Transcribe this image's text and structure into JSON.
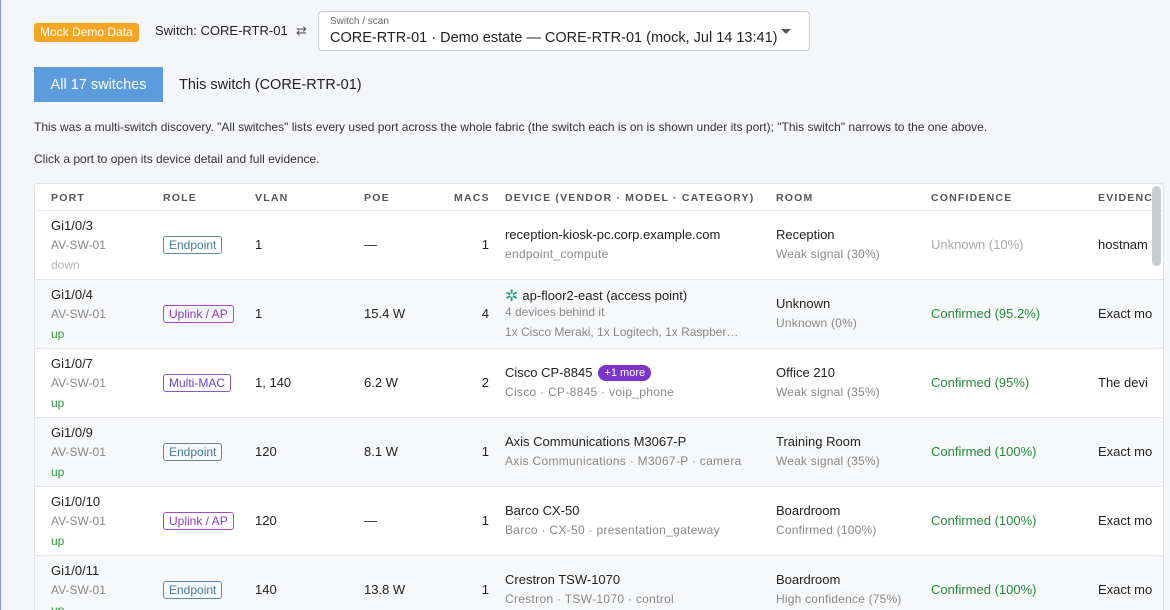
{
  "header": {
    "mock_badge": "Mock Demo Data",
    "switch_label": "Switch: CORE-RTR-01",
    "swap_icon": "swap-arrows-icon",
    "select_legend": "Switch / scan",
    "select_value": "CORE-RTR-01 · Demo estate — CORE-RTR-01 (mock, Jul 14 13:41)"
  },
  "tabs": {
    "all": "All 17 switches",
    "this": "This switch (CORE-RTR-01)"
  },
  "info": {
    "line1": "This was a multi-switch discovery. \"All switches\" lists every used port across the whole fabric (the switch each is on is shown under its port); \"This switch\" narrows to the one above.",
    "line2": "Click a port to open its device detail and full evidence."
  },
  "table": {
    "columns": [
      "PORT",
      "ROLE",
      "VLAN",
      "POE",
      "MACS",
      "DEVICE (VENDOR · MODEL · CATEGORY)",
      "ROOM",
      "CONFIDENCE",
      "EVIDENCE"
    ],
    "rows": [
      {
        "port": "Gi1/0/3",
        "switch": "AV-SW-01",
        "status": "down",
        "role": "Endpoint",
        "vlan": "1",
        "poe": "—",
        "macs": "1",
        "device": "reception-kiosk-pc.corp.example.com",
        "device_sub": "endpoint_compute",
        "room": "Reception",
        "room_sub": "Weak signal (30%)",
        "confidence": "Unknown (10%)",
        "evidence": "hostnam"
      },
      {
        "port": "Gi1/0/4",
        "switch": "AV-SW-01",
        "status": "up",
        "role": "Uplink / AP",
        "vlan": "1",
        "poe": "15.4 W",
        "macs": "4",
        "device": "ap-floor2-east (access point)",
        "device_sub": "4 devices behind it",
        "device_sub2": "1x Cisco Meraki, 1x Logitech, 1x Raspber…",
        "room": "Unknown",
        "room_sub": "Unknown (0%)",
        "confidence": "Confirmed (95.2%)",
        "evidence": "Exact mo"
      },
      {
        "port": "Gi1/0/7",
        "switch": "AV-SW-01",
        "status": "up",
        "role": "Multi-MAC",
        "vlan": "1, 140",
        "poe": "6.2 W",
        "macs": "2",
        "device": "Cisco CP-8845",
        "more": "+1 more",
        "device_sub": "Cisco · CP-8845 · voip_phone",
        "room": "Office 210",
        "room_sub": "Weak signal (35%)",
        "confidence": "Confirmed (95%)",
        "evidence": "The devi"
      },
      {
        "port": "Gi1/0/9",
        "switch": "AV-SW-01",
        "status": "up",
        "role": "Endpoint",
        "vlan": "120",
        "poe": "8.1 W",
        "macs": "1",
        "device": "Axis Communications M3067-P",
        "device_sub": "Axis Communications · M3067-P · camera",
        "room": "Training Room",
        "room_sub": "Weak signal (35%)",
        "confidence": "Confirmed (100%)",
        "evidence": "Exact mo"
      },
      {
        "port": "Gi1/0/10",
        "switch": "AV-SW-01",
        "status": "up",
        "role": "Uplink / AP",
        "vlan": "120",
        "poe": "—",
        "macs": "1",
        "device": "Barco CX-50",
        "device_sub": "Barco · CX-50 · presentation_gateway",
        "room": "Boardroom",
        "room_sub": "Confirmed (100%)",
        "confidence": "Confirmed (100%)",
        "evidence": "Exact mo"
      },
      {
        "port": "Gi1/0/11",
        "switch": "AV-SW-01",
        "status": "up",
        "role": "Endpoint",
        "vlan": "140",
        "poe": "13.8 W",
        "macs": "1",
        "device": "Crestron TSW-1070",
        "device_sub": "Crestron · TSW-1070 · control",
        "room": "Boardroom",
        "room_sub": "High confidence (75%)",
        "confidence": "Confirmed (100%)",
        "evidence": "Exact mo"
      }
    ]
  }
}
